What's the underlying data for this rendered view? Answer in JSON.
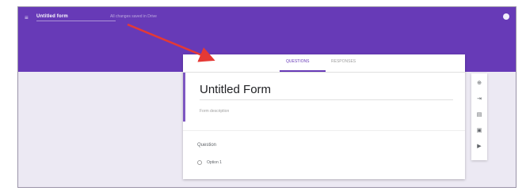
{
  "header": {
    "menu_icon": "menu-icon",
    "doc_title": "Untitled form",
    "saved_status": "All changes saved in Drive",
    "avatar_icon": "account-avatar-icon"
  },
  "tabs": [
    {
      "label": "QUESTIONS",
      "active": true
    },
    {
      "label": "RESPONSES",
      "active": false
    }
  ],
  "form": {
    "title": "Untitled Form",
    "description_placeholder": "Form description"
  },
  "question": {
    "title": "Question",
    "option_label": "Option 1"
  },
  "toolbar": {
    "icons": [
      "add-question-icon",
      "import-questions-icon",
      "add-title-icon",
      "add-image-icon",
      "add-video-icon"
    ]
  },
  "annotation": {
    "arrow_color": "#e53935"
  },
  "colors": {
    "accent": "#673ab7",
    "background": "#ece9f3"
  }
}
